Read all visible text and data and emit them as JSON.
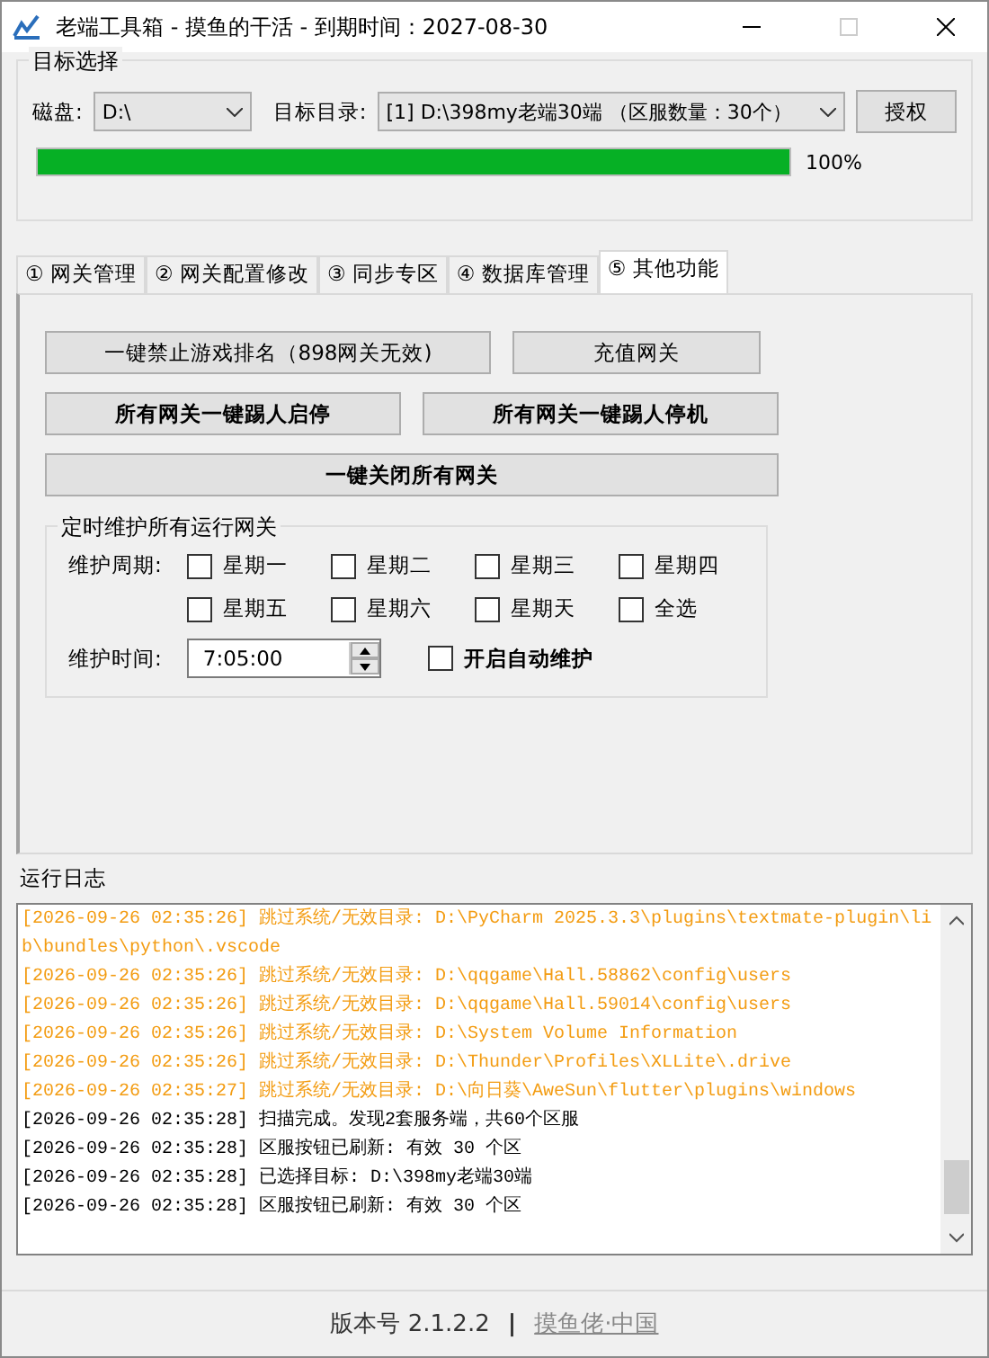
{
  "window": {
    "title": "老端工具箱 - 摸鱼的干活 - 到期时间：2027-08-30"
  },
  "target": {
    "title": "目标选择",
    "disk_label": "磁盘:",
    "disk_value": "D:\\",
    "dir_label": "目标目录:",
    "dir_value": "[1] D:\\398my老端30端 （区服数量：30个）",
    "auth_button": "授权",
    "progress": {
      "level": 1,
      "reading": "100%"
    }
  },
  "tabs": [
    {
      "label": "① 网关管理",
      "selected": false
    },
    {
      "label": "② 网关配置修改",
      "selected": false
    },
    {
      "label": "③ 同步专区",
      "selected": false
    },
    {
      "label": "④ 数据库管理",
      "selected": false
    },
    {
      "label": "⑤ 其他功能",
      "selected": true
    }
  ],
  "buttons": [
    {
      "label": "一键禁止游戏排名（898网关无效)",
      "bold": false
    },
    {
      "label": "充值网关",
      "bold": false
    },
    {
      "label": "所有网关一键踢人启停",
      "bold": true
    },
    {
      "label": "所有网关一键踢人停机",
      "bold": true
    },
    {
      "label": "一键关闭所有网关",
      "bold": true
    }
  ],
  "schedule": {
    "title": "定时维护所有运行网关",
    "period_label": "维护周期:",
    "days": [
      {
        "label": "星期一",
        "checked": false
      },
      {
        "label": "星期二",
        "checked": false
      },
      {
        "label": "星期三",
        "checked": false
      },
      {
        "label": "星期四",
        "checked": false
      },
      {
        "label": "星期五",
        "checked": false
      },
      {
        "label": "星期六",
        "checked": false
      },
      {
        "label": "星期天",
        "checked": false
      },
      {
        "label": "全选",
        "checked": false
      }
    ],
    "time_label": "维护时间:",
    "time_value": "7:05:00",
    "auto": {
      "label": "开启自动维护",
      "checked": false
    }
  },
  "log": {
    "title": "运行日志",
    "lines": [
      {
        "text": "[2026-09-26 02:35:26] 跳过系统/无效目录: D:\\PyCharm 2025.3.3\\plugins\\textmate-plugin\\lib\\bundles\\python\\.vscode",
        "kind": "warn"
      },
      {
        "text": "[2026-09-26 02:35:26] 跳过系统/无效目录: D:\\qqgame\\Hall.58862\\config\\users",
        "kind": "warn"
      },
      {
        "text": "[2026-09-26 02:35:26] 跳过系统/无效目录: D:\\qqgame\\Hall.59014\\config\\users",
        "kind": "warn"
      },
      {
        "text": "[2026-09-26 02:35:26] 跳过系统/无效目录: D:\\System Volume Information",
        "kind": "warn"
      },
      {
        "text": "[2026-09-26 02:35:26] 跳过系统/无效目录: D:\\Thunder\\Profiles\\XLLite\\.drive",
        "kind": "warn"
      },
      {
        "text": "[2026-09-26 02:35:27] 跳过系统/无效目录: D:\\向日葵\\AweSun\\flutter\\plugins\\windows",
        "kind": "warn"
      },
      {
        "text": "[2026-09-26 02:35:28] 扫描完成。发现2套服务端，共60个区服",
        "kind": "info"
      },
      {
        "text": "[2026-09-26 02:35:28] 区服按钮已刷新: 有效 30 个区",
        "kind": "info"
      },
      {
        "text": "[2026-09-26 02:35:28] 已选择目标: D:\\398my老端30端",
        "kind": "info"
      },
      {
        "text": "[2026-09-26 02:35:28] 区服按钮已刷新: 有效 30 个区",
        "kind": "info"
      }
    ]
  },
  "footer": {
    "version": "版本号 2.1.2.2",
    "separator": "|",
    "link": "摸鱼佬·中国"
  }
}
